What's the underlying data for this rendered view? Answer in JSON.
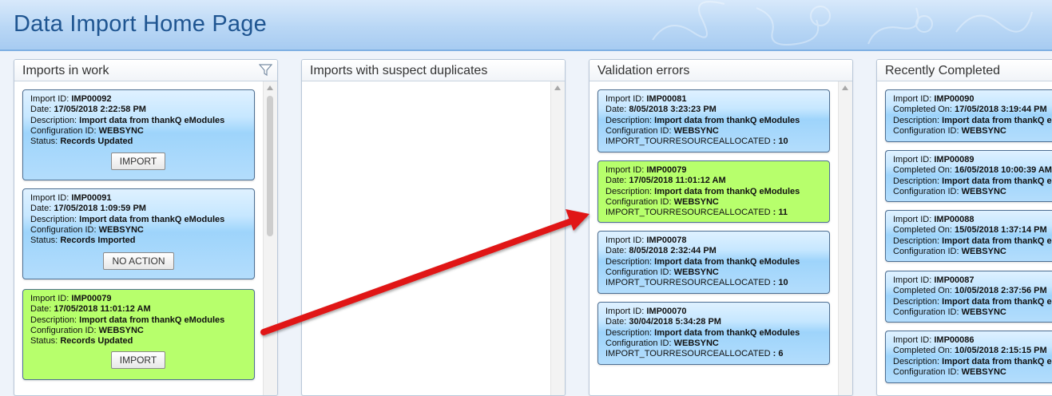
{
  "page": {
    "title": "Data Import Home Page"
  },
  "labels": {
    "import_id": "Import ID:",
    "date": "Date:",
    "description": "Description:",
    "configuration_id": "Configuration ID:",
    "status": "Status:",
    "completed_on": "Completed On:",
    "tour_resource": "IMPORT_TOURRESOURCEALLOCATED"
  },
  "panels": {
    "in_work": {
      "title": "Imports in work",
      "cards": [
        {
          "import_id": "IMP00092",
          "date": "17/05/2018 2:22:58 PM",
          "description": "Import data from thankQ eModules",
          "configuration_id": "WEBSYNC",
          "status": "Records Updated",
          "button": "IMPORT"
        },
        {
          "import_id": "IMP00091",
          "date": "17/05/2018 1:09:59 PM",
          "description": "Import data from thankQ eModules",
          "configuration_id": "WEBSYNC",
          "status": "Records Imported",
          "button": "NO ACTION"
        },
        {
          "import_id": "IMP00079",
          "date": "17/05/2018 11:01:12 AM",
          "description": "Import data from thankQ eModules",
          "configuration_id": "WEBSYNC",
          "status": "Records Updated",
          "button": "IMPORT"
        }
      ]
    },
    "duplicates": {
      "title": "Imports with suspect duplicates"
    },
    "validation": {
      "title": "Validation errors",
      "cards": [
        {
          "import_id": "IMP00081",
          "date": "8/05/2018 3:23:23 PM",
          "description": "Import data from thankQ eModules",
          "configuration_id": "WEBSYNC",
          "tour_resource_value": ": 10"
        },
        {
          "import_id": "IMP00079",
          "date": "17/05/2018 11:01:12 AM",
          "description": "Import data from thankQ eModules",
          "configuration_id": "WEBSYNC",
          "tour_resource_value": ": 11"
        },
        {
          "import_id": "IMP00078",
          "date": "8/05/2018 2:32:44 PM",
          "description": "Import data from thankQ eModules",
          "configuration_id": "WEBSYNC",
          "tour_resource_value": ": 10"
        },
        {
          "import_id": "IMP00070",
          "date": "30/04/2018 5:34:28 PM",
          "description": "Import data from thankQ eModules",
          "configuration_id": "WEBSYNC",
          "tour_resource_value": ": 6"
        }
      ]
    },
    "completed": {
      "title": "Recently Completed",
      "cards": [
        {
          "import_id": "IMP00090",
          "completed_on": "17/05/2018 3:19:44 PM",
          "description": "Import data from thankQ eModules",
          "configuration_id": "WEBSYNC"
        },
        {
          "import_id": "IMP00089",
          "completed_on": "16/05/2018 10:00:39 AM",
          "description": "Import data from thankQ eModules",
          "configuration_id": "WEBSYNC"
        },
        {
          "import_id": "IMP00088",
          "completed_on": "15/05/2018 1:37:14 PM",
          "description": "Import data from thankQ eModules",
          "configuration_id": "WEBSYNC"
        },
        {
          "import_id": "IMP00087",
          "completed_on": "10/05/2018 2:37:56 PM",
          "description": "Import data from thankQ eModules",
          "configuration_id": "WEBSYNC"
        },
        {
          "import_id": "IMP00086",
          "completed_on": "10/05/2018 2:15:15 PM",
          "description": "Import data from thankQ eModules",
          "configuration_id": "WEBSYNC"
        }
      ]
    }
  },
  "colors": {
    "card_blue": "#9ed4fb",
    "card_green": "#b7ff6c",
    "header_title": "#1f5591",
    "arrow": "#e01414"
  },
  "icons": {
    "filter": "filter-icon",
    "header_background": "puzzle-pattern-icon"
  }
}
